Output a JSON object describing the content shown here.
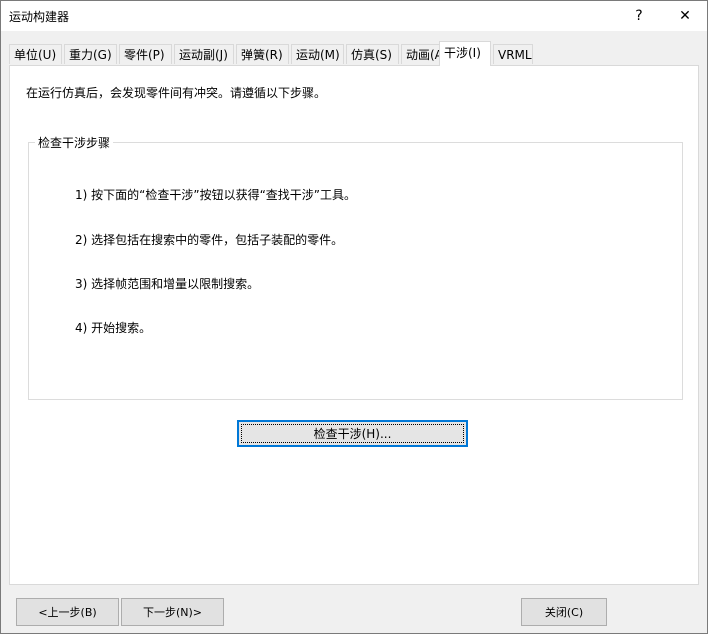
{
  "window": {
    "title": "运动构建器"
  },
  "titlebar": {
    "help_glyph": "?",
    "close_glyph": "✕"
  },
  "tabs": [
    {
      "label": "单位(U)"
    },
    {
      "label": "重力(G)"
    },
    {
      "label": "零件(P)"
    },
    {
      "label": "运动副(J)"
    },
    {
      "label": "弹簧(R)"
    },
    {
      "label": "运动(M)"
    },
    {
      "label": "仿真(S)"
    },
    {
      "label": "动画(A)"
    },
    {
      "label": "干涉(I)",
      "active": true
    },
    {
      "label": "VRML"
    }
  ],
  "panel": {
    "intro": "在运行仿真后，会发现零件间有冲突。请遵循以下步骤。",
    "group_title": "检查干涉步骤",
    "steps": [
      "1) 按下面的“检查干涉”按钮以获得“查找干涉”工具。",
      "2) 选择包括在搜索中的零件，包括子装配的零件。",
      "3) 选择帧范围和增量以限制搜索。",
      "4) 开始搜索。"
    ],
    "check_button": "检查干涉(H)..."
  },
  "footer": {
    "prev_button": "<上一步(B)",
    "next_button": "下一步(N)>",
    "close_button": "关闭(C)"
  },
  "colors": {
    "focus_border": "#0078d7",
    "panel_bg": "#ffffff",
    "window_bg": "#f0f0f0"
  }
}
